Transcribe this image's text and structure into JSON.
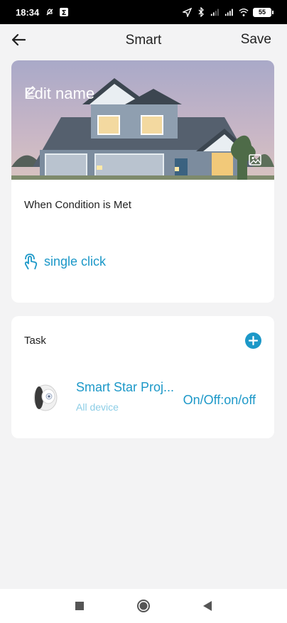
{
  "status_bar": {
    "time": "18:34",
    "battery": "55"
  },
  "header": {
    "title": "Smart",
    "save_label": "Save"
  },
  "condition_card": {
    "edit_name_label": "Edit name",
    "condition_title": "When Condition is Met",
    "trigger_label": "single click"
  },
  "task_card": {
    "title": "Task",
    "tasks": [
      {
        "device_name": "Smart Star Proj...",
        "device_sub": "All device",
        "action": "On/Off:on/off"
      }
    ]
  },
  "colors": {
    "accent": "#1c98c8",
    "accent_light": "#8ccde6",
    "background": "#f3f3f4",
    "card": "#ffffff"
  },
  "icons": {
    "back": "arrow-left-icon",
    "edit": "pencil-icon",
    "image": "image-icon",
    "touch": "touch-icon",
    "add": "plus-circle-icon",
    "nav_recent": "square-icon",
    "nav_home": "circle-icon",
    "nav_back": "triangle-back-icon"
  }
}
